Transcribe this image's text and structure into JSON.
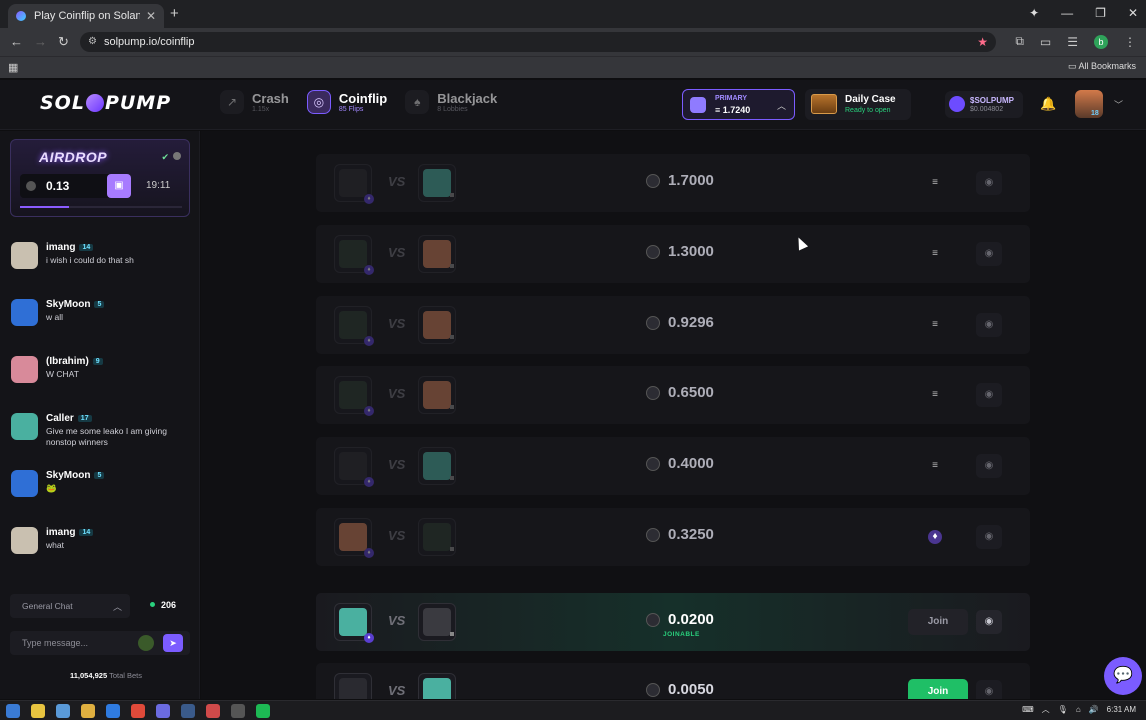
{
  "browser": {
    "tab_title": "Play Coinflip on Solana – No K",
    "tab_close": "✕",
    "new_tab": "+",
    "url": "solpump.io/coinflip",
    "bookmarks_label": "All Bookmarks",
    "profile_initial": "b"
  },
  "header": {
    "logo_left": "SOL",
    "logo_right": "PUMP",
    "games": [
      {
        "name": "Crash",
        "sub": "1.15x",
        "icon": "↗"
      },
      {
        "name": "Coinflip",
        "sub": "85 Flips",
        "icon": "◎"
      },
      {
        "name": "Blackjack",
        "sub": "8 Lobbies",
        "icon": "♠"
      }
    ],
    "balance": {
      "label": "PRIMARY",
      "amount": "≡ 1.7240"
    },
    "daily_case": {
      "title": "Daily Case",
      "status": "Ready to open"
    },
    "token": {
      "name": "$SOLPUMP",
      "price": "$0.004802"
    },
    "user_level": "18"
  },
  "airdrop": {
    "title": "AIRDROP",
    "amount": "0.13",
    "timer": "19:11",
    "progress": 0.3
  },
  "chat": {
    "messages": [
      {
        "name": "imang",
        "level": "14",
        "text": "i wish i could do that sh",
        "avatar_color": "#c9c0b0"
      },
      {
        "name": "SkyMoon",
        "level": "5",
        "text": "w all",
        "avatar_color": "#2f6fd6"
      },
      {
        "name": "(Ibrahim)",
        "level": "9",
        "text": "W CHAT",
        "avatar_color": "#d88a9a"
      },
      {
        "name": "Caller",
        "level": "17",
        "text": "Give me some leako I am giving nonstop winners",
        "avatar_color": "#4ab0a0"
      },
      {
        "name": "SkyMoon",
        "level": "5",
        "text": "🐸",
        "avatar_color": "#2f6fd6"
      },
      {
        "name": "imang",
        "level": "14",
        "text": "what",
        "avatar_color": "#c9c0b0"
      }
    ],
    "channel": "General Chat",
    "online": "206",
    "placeholder": "Type message...",
    "total_bets_value": "11,054,925",
    "total_bets_label": "Total Bets"
  },
  "flips": [
    {
      "amount": "1.7000",
      "state": "done",
      "status": "≡"
    },
    {
      "amount": "1.3000",
      "state": "done",
      "status": "≡"
    },
    {
      "amount": "0.9296",
      "state": "done",
      "status": "≡"
    },
    {
      "amount": "0.6500",
      "state": "done",
      "status": "≡"
    },
    {
      "amount": "0.4000",
      "state": "done",
      "status": "≡"
    },
    {
      "amount": "0.3250",
      "state": "done",
      "status": "♦"
    },
    {
      "amount": "0.0200",
      "state": "joinable",
      "joinable_label": "JOINABLE",
      "join_label": "Join"
    },
    {
      "amount": "0.0050",
      "state": "open",
      "join_label": "Join"
    }
  ],
  "taskbar": {
    "time": "6:31 AM"
  },
  "colors": {
    "accent": "#7b5cff",
    "join_green": "#1fbf66",
    "joinable_green": "#29d17d"
  }
}
